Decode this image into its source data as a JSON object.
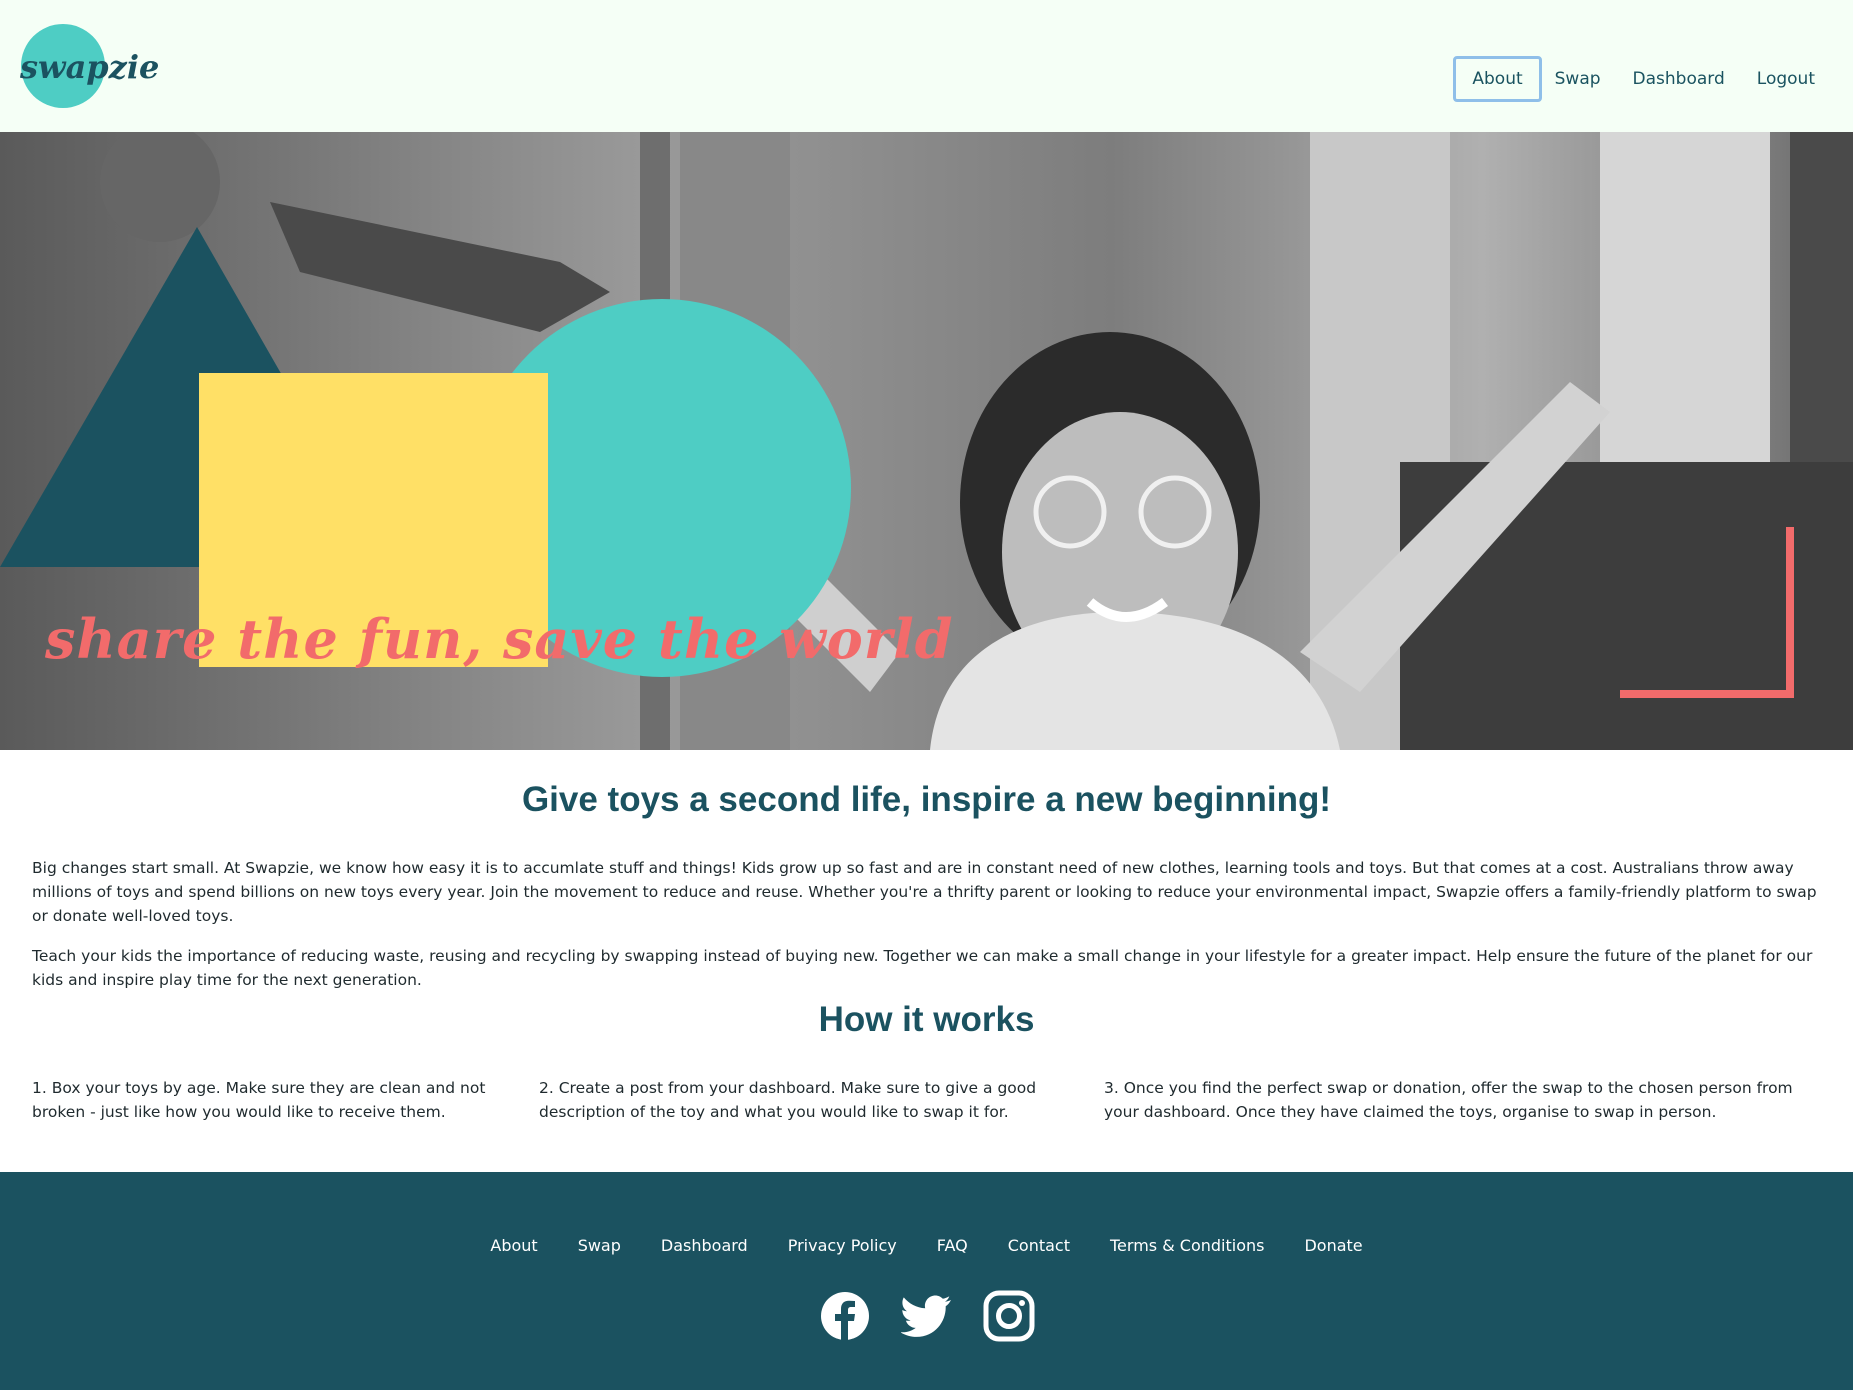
{
  "brand": {
    "logo_text": "swapzie",
    "colors": {
      "teal_dark": "#1b5260",
      "teal_light": "#4ecdc4",
      "yellow": "#ffe066",
      "coral": "#f26b6b",
      "nav_bg": "#f5fff6"
    }
  },
  "nav": {
    "items": [
      {
        "label": "About",
        "active": true
      },
      {
        "label": "Swap",
        "active": false
      },
      {
        "label": "Dashboard",
        "active": false
      },
      {
        "label": "Logout",
        "active": false
      }
    ]
  },
  "hero": {
    "tagline": "share the fun, save the world"
  },
  "main": {
    "heading": "Give toys a second life, inspire a new beginning!",
    "paragraphs": [
      "Big changes start small. At Swapzie, we know how easy it is to accumlate stuff and things! Kids grow up so fast and are in constant need of new clothes, learning tools and toys. But that comes at a cost. Australians throw away millions of toys and spend billions on new toys every year. Join the movement to reduce and reuse. Whether you're a thrifty parent or looking to reduce your environmental impact, Swapzie offers a family-friendly platform to swap or donate well-loved toys.",
      "Teach your kids the importance of reducing waste, reusing and recycling by swapping instead of buying new. Together we can make a small change in your lifestyle for a greater impact. Help ensure the future of the planet for our kids and inspire play time for the next generation."
    ]
  },
  "how": {
    "heading": "How it works",
    "steps": [
      "1. Box your toys by age. Make sure they are clean and not broken - just like how you would like to receive them.",
      "2. Create a post from your dashboard. Make sure to give a good description of the toy and what you would like to swap it for.",
      "3. Once you find the perfect swap or donation, offer the swap to the chosen person from your dashboard. Once they have claimed the toys, organise to swap in person."
    ]
  },
  "footer": {
    "links": [
      "About",
      "Swap",
      "Dashboard",
      "Privacy Policy",
      "FAQ",
      "Contact",
      "Terms & Conditions",
      "Donate"
    ],
    "social": [
      "facebook-icon",
      "twitter-icon",
      "instagram-icon"
    ]
  }
}
